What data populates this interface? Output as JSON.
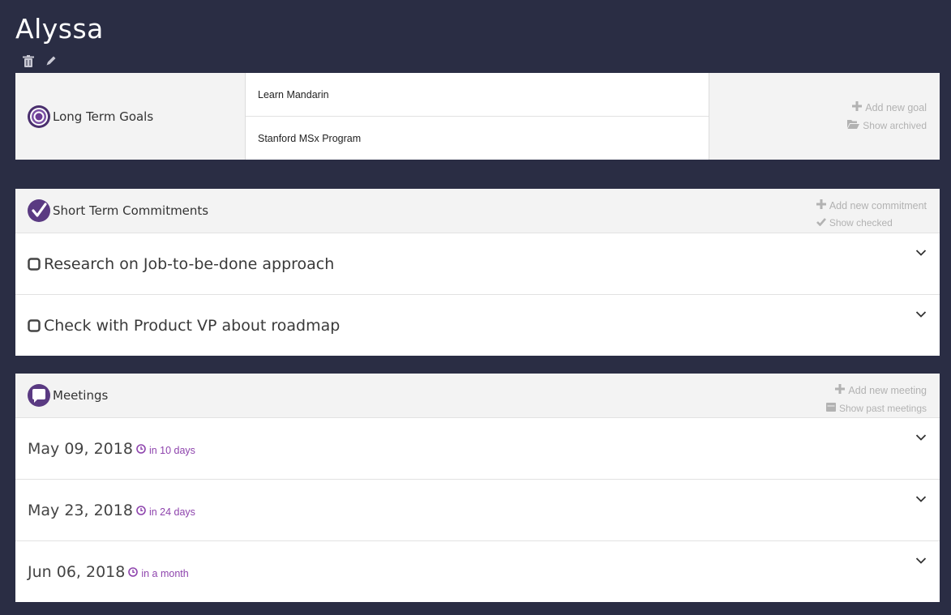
{
  "page": {
    "title": "Alyssa"
  },
  "goals": {
    "label": "Long Term Goals",
    "items": [
      "Learn Mandarin",
      "Stanford MSx Program"
    ],
    "add_label": "Add new goal",
    "archived_label": "Show archived"
  },
  "commitments": {
    "label": "Short Term Commitments",
    "add_label": "Add new commitment",
    "checked_label": "Show checked",
    "items": [
      "Research on Job-to-be-done approach",
      "Check with Product VP about roadmap"
    ]
  },
  "meetings": {
    "label": "Meetings",
    "add_label": "Add new meeting",
    "past_label": "Show past meetings",
    "items": [
      {
        "date": "May 09, 2018",
        "relative": "in 10 days"
      },
      {
        "date": "May 23, 2018",
        "relative": "in 24 days"
      },
      {
        "date": "Jun 06, 2018",
        "relative": "in a month"
      }
    ]
  },
  "colors": {
    "background": "#2a2d44",
    "accent": "#8e44ad",
    "muted": "#b2b2b2"
  }
}
